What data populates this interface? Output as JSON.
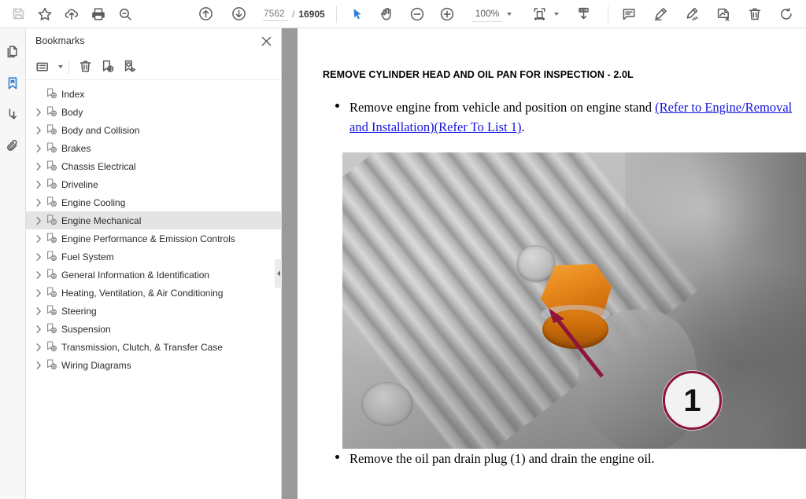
{
  "toolbar": {
    "save_label": "save-icon",
    "bookmark_label": "star-icon",
    "upload_label": "cloud-upload-icon",
    "print_label": "print-icon",
    "search_label": "search-icon",
    "prev_page_label": "arrow-up-circle-icon",
    "next_page_label": "arrow-down-circle-icon",
    "current_page": "7562",
    "page_separator": "/",
    "total_pages": "16905",
    "select_tool": "cursor-icon",
    "pan_tool": "hand-icon",
    "zoom_out": "zoom-out-icon",
    "zoom_in": "zoom-in-icon",
    "zoom_level": "100%",
    "fit_page": "fit-page-icon",
    "page_fit_down": "page-fit-icon",
    "comment": "comment-icon",
    "highlight": "highlighter-icon",
    "draw": "draw-icon",
    "stamp": "stamp-icon",
    "delete": "trash-icon",
    "rotate": "rotate-icon"
  },
  "rail": {
    "items": [
      {
        "name": "thumbnails",
        "icon": "pages-icon",
        "active": false
      },
      {
        "name": "bookmarks",
        "icon": "bookmark-icon",
        "active": true
      },
      {
        "name": "signatures",
        "icon": "signature-icon",
        "active": false
      },
      {
        "name": "attachments",
        "icon": "paperclip-icon",
        "active": false
      }
    ]
  },
  "bookmarks_panel": {
    "title": "Bookmarks",
    "close_label": "close-icon",
    "tools": {
      "options": "list-options-icon",
      "delete": "trash-icon",
      "add": "add-bookmark-icon",
      "edit": "edit-bookmark-icon"
    },
    "items": [
      {
        "label": "Index",
        "expandable": false,
        "selected": false
      },
      {
        "label": "Body",
        "expandable": true,
        "selected": false
      },
      {
        "label": "Body and Collision",
        "expandable": true,
        "selected": false
      },
      {
        "label": "Brakes",
        "expandable": true,
        "selected": false
      },
      {
        "label": "Chassis Electrical",
        "expandable": true,
        "selected": false
      },
      {
        "label": "Driveline",
        "expandable": true,
        "selected": false
      },
      {
        "label": "Engine Cooling",
        "expandable": true,
        "selected": false
      },
      {
        "label": "Engine Mechanical",
        "expandable": true,
        "selected": true
      },
      {
        "label": "Engine Performance & Emission Controls",
        "expandable": true,
        "selected": false
      },
      {
        "label": "Fuel System",
        "expandable": true,
        "selected": false
      },
      {
        "label": "General Information & Identification",
        "expandable": true,
        "selected": false
      },
      {
        "label": "Heating, Ventilation, & Air Conditioning",
        "expandable": true,
        "selected": false
      },
      {
        "label": "Steering",
        "expandable": true,
        "selected": false
      },
      {
        "label": "Suspension",
        "expandable": true,
        "selected": false
      },
      {
        "label": "Transmission, Clutch, & Transfer Case",
        "expandable": true,
        "selected": false
      },
      {
        "label": "Wiring Diagrams",
        "expandable": true,
        "selected": false
      }
    ]
  },
  "document": {
    "heading": "REMOVE CYLINDER HEAD AND OIL PAN FOR INSPECTION - 2.0L",
    "step1_text_before": "Remove engine from vehicle and position on engine stand ",
    "step1_link": "(Refer to Engine/Removal and Installation)(Refer To List 1)",
    "step1_text_after": ".",
    "step2_text": "Remove the oil pan drain plug (1) and drain the engine oil.",
    "figure": {
      "alt": "Oil pan with drain plug highlighted in orange",
      "callout_number": "1"
    }
  },
  "colors": {
    "accent_blue": "#2f7fd8",
    "link_blue": "#1414dd",
    "callout_red": "#8e1538",
    "plug_orange": "#e8891d",
    "selection_gray": "#e4e4e4"
  }
}
